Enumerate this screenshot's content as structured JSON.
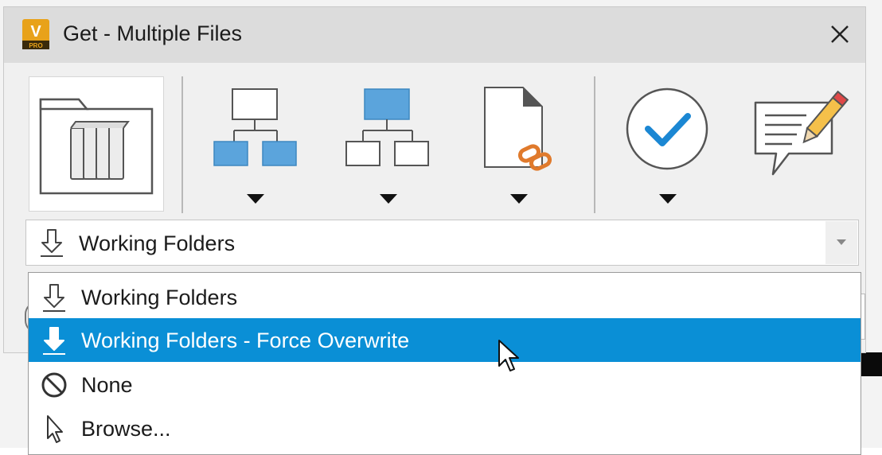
{
  "window": {
    "title": "Get - Multiple Files",
    "app_logo_text": "V",
    "app_logo_subtext": "PRO",
    "close_icon": "close-icon"
  },
  "toolbar": {
    "buttons": [
      {
        "name": "get-files-button",
        "icon": "folder-files-icon"
      },
      {
        "name": "children-button",
        "icon": "children-hierarchy-icon",
        "has_dropdown": true
      },
      {
        "name": "parents-button",
        "icon": "parents-hierarchy-icon",
        "has_dropdown": true
      },
      {
        "name": "attachments-button",
        "icon": "file-link-icon",
        "has_dropdown": true
      },
      {
        "name": "select-button",
        "icon": "checkmark-circle-icon",
        "has_dropdown": true
      },
      {
        "name": "comment-button",
        "icon": "comment-pencil-icon"
      }
    ],
    "colors": {
      "accent_blue": "#5ba4dc",
      "link_orange": "#e07a2c",
      "check_blue": "#1b87d3"
    }
  },
  "combo": {
    "selected_value": "Working Folders",
    "selected_icon": "download-arrow-icon"
  },
  "dropdown": {
    "options": [
      {
        "label": "Working Folders",
        "icon": "download-arrow-icon",
        "selected": false
      },
      {
        "label": "Working Folders - Force Overwrite",
        "icon": "download-arrow-bold-icon",
        "selected": true
      },
      {
        "label": "None",
        "icon": "prohibited-icon",
        "selected": false
      },
      {
        "label": "Browse...",
        "icon": "pointer-icon",
        "selected": false
      }
    ],
    "highlight_color": "#0a8fd6"
  }
}
